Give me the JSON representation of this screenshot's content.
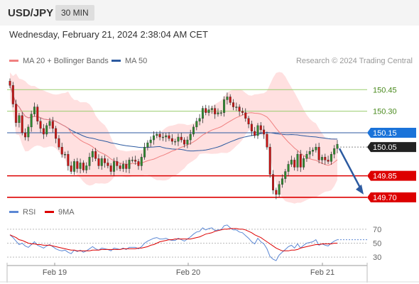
{
  "header": {
    "symbol": "USD/JPY",
    "interval": "30 MIN",
    "datetime": "Wednesday, February 21, 2024 2:38:04 AM CET"
  },
  "legend": {
    "ma20": "MA 20 + Bollinger Bands",
    "ma50": "MA 50",
    "credit": "Research © 2024 Trading Central"
  },
  "rsi_legend": {
    "rsi": "RSI",
    "ma": "9MA"
  },
  "colors": {
    "ma20": "#f08080",
    "bands": "#ffe0e0",
    "ma50": "#2c5aa0",
    "bull": "#2e8b2e",
    "bear": "#cc1111",
    "level_green": "#9acd6e",
    "level_red": "#dd0000",
    "level_blue": "#2c5aa0",
    "label_blue": "#1a73d9",
    "rsi": "#5b87d4",
    "rsi_ma": "#dd0000"
  },
  "chart_data": [
    {
      "type": "candlestick",
      "title": "USD/JPY 30 MIN",
      "x_tick_labels": [
        "Feb 19",
        "Feb 20",
        "Feb 21"
      ],
      "ylim": [
        149.68,
        150.58
      ],
      "horizontal_levels": [
        {
          "value": 150.45,
          "label": "150.45",
          "style": "green-line"
        },
        {
          "value": 150.3,
          "label": "150.30",
          "style": "green-line"
        },
        {
          "value": 150.15,
          "label": "150.15",
          "style": "blue-tag"
        },
        {
          "value": 150.05,
          "label": "150.05",
          "style": "current-price-tag"
        },
        {
          "value": 149.85,
          "label": "149.85",
          "style": "red-tag"
        },
        {
          "value": 149.7,
          "label": "149.70",
          "style": "red-tag"
        }
      ],
      "projection": {
        "from": 150.05,
        "to": 149.72
      },
      "close": [
        150.48,
        150.35,
        150.22,
        150.27,
        150.15,
        150.12,
        150.19,
        150.28,
        150.33,
        150.23,
        150.18,
        150.14,
        150.2,
        150.23,
        150.18,
        150.11,
        150.05,
        150.0,
        150.0,
        149.92,
        149.88,
        149.95,
        149.9,
        149.94,
        149.89,
        149.92,
        149.98,
        150.02,
        149.97,
        149.92,
        149.97,
        149.94,
        149.92,
        149.88,
        149.95,
        149.92,
        149.9,
        149.93,
        149.9,
        149.96,
        149.96,
        149.95,
        149.92,
        149.98,
        150.05,
        150.08,
        150.1,
        150.13,
        150.14,
        150.12,
        150.12,
        150.13,
        150.11,
        150.09,
        150.09,
        150.12,
        150.1,
        150.07,
        150.1,
        150.14,
        150.19,
        150.23,
        150.25,
        150.32,
        150.29,
        150.31,
        150.32,
        150.28,
        150.29,
        150.29,
        150.38,
        150.4,
        150.36,
        150.33,
        150.33,
        150.3,
        150.29,
        150.25,
        150.21,
        150.16,
        150.13,
        150.2,
        150.17,
        150.14,
        150.05,
        149.86,
        149.75,
        149.72,
        149.79,
        149.83,
        149.88,
        149.93,
        149.96,
        149.91,
        150.0,
        149.91,
        149.97,
        150.0,
        150.02,
        150.03,
        150.05,
        149.96,
        149.98,
        149.96,
        149.95,
        150.0,
        150.04,
        150.07
      ]
    },
    {
      "type": "line",
      "title": "RSI",
      "y_tick_labels": [
        "70",
        "50",
        "30"
      ],
      "ylim": [
        20,
        80
      ],
      "series": [
        {
          "name": "RSI",
          "values": [
            62,
            58,
            53,
            48,
            50,
            46,
            44,
            48,
            52,
            47,
            45,
            43,
            46,
            48,
            45,
            42,
            40,
            39,
            40,
            37,
            35,
            40,
            38,
            40,
            37,
            39,
            42,
            45,
            42,
            40,
            43,
            42,
            41,
            39,
            43,
            42,
            41,
            43,
            41,
            44,
            44,
            44,
            42,
            45,
            50,
            53,
            55,
            57,
            58,
            56,
            56,
            57,
            55,
            54,
            54,
            57,
            55,
            53,
            56,
            59,
            63,
            66,
            67,
            72,
            69,
            71,
            72,
            68,
            69,
            69,
            75,
            76,
            72,
            69,
            69,
            66,
            65,
            61,
            57,
            52,
            49,
            57,
            52,
            49,
            42,
            31,
            27,
            25,
            33,
            37,
            41,
            45,
            47,
            43,
            49,
            43,
            47,
            50,
            51,
            52,
            55,
            47,
            49,
            47,
            46,
            50,
            53,
            55
          ]
        },
        {
          "name": "9MA",
          "values": [
            62,
            60,
            58,
            55,
            54,
            52,
            50,
            49,
            49,
            48,
            48,
            47,
            47,
            47,
            46,
            45,
            44,
            43,
            42,
            41,
            40,
            40,
            39,
            39,
            39,
            39,
            39,
            40,
            40,
            40,
            41,
            41,
            41,
            41,
            41,
            41,
            41,
            42,
            42,
            42,
            42,
            42,
            43,
            43,
            44,
            45,
            47,
            48,
            50,
            52,
            53,
            54,
            55,
            55,
            56,
            56,
            56,
            56,
            56,
            56,
            57,
            58,
            59,
            61,
            63,
            64,
            65,
            67,
            68,
            69,
            70,
            70,
            71,
            71,
            71,
            70,
            70,
            69,
            67,
            65,
            62,
            60,
            58,
            55,
            52,
            49,
            46,
            43,
            41,
            39,
            39,
            39,
            40,
            40,
            41,
            43,
            44,
            45,
            46,
            47,
            48,
            48,
            49,
            49,
            49,
            49,
            50,
            50
          ]
        }
      ]
    }
  ]
}
